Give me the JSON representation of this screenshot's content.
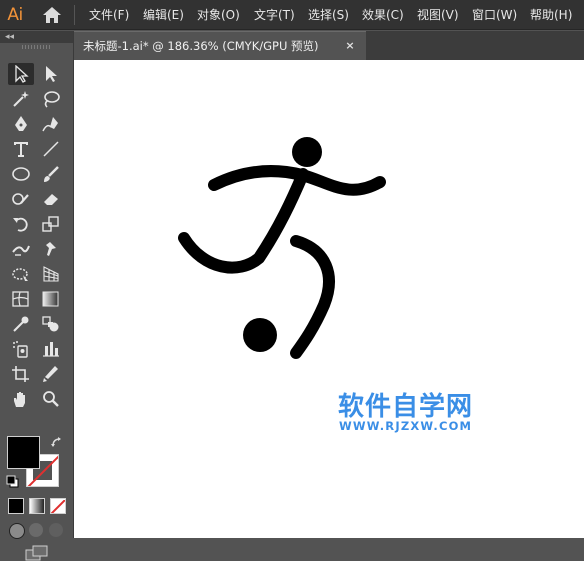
{
  "app": {
    "logo": "Ai"
  },
  "menu": [
    {
      "label": "文件(F)"
    },
    {
      "label": "编辑(E)"
    },
    {
      "label": "对象(O)"
    },
    {
      "label": "文字(T)"
    },
    {
      "label": "选择(S)"
    },
    {
      "label": "效果(C)"
    },
    {
      "label": "视图(V)"
    },
    {
      "label": "窗口(W)"
    },
    {
      "label": "帮助(H)"
    }
  ],
  "document_tab": {
    "title": "未标题-1.ai* @ 186.36% (CMYK/GPU 预览)",
    "close": "×"
  },
  "toolbar": {
    "collapse": "◂◂"
  },
  "colors": {
    "accent": "#f29339",
    "watermark": "#3a8ee6",
    "fill": "#000000",
    "stroke": "#ffffff"
  },
  "watermark": {
    "title": "软件自学网",
    "url": "WWW.RJZXW.COM"
  },
  "tools": [
    "selection-icon",
    "direct-selection-icon",
    "magic-wand-icon",
    "lasso-icon",
    "pen-icon",
    "curvature-icon",
    "type-icon",
    "line-segment-icon",
    "ellipse-icon",
    "paintbrush-icon",
    "shaper-icon",
    "eraser-icon",
    "rotate-icon",
    "scale-icon",
    "width-icon",
    "puppet-warp-icon",
    "free-transform-icon",
    "perspective-grid-icon",
    "mesh-icon",
    "gradient-icon",
    "eyedropper-icon",
    "blend-icon",
    "symbol-sprayer-icon",
    "column-graph-icon",
    "artboard-icon",
    "slice-icon",
    "hand-icon",
    "zoom-icon"
  ]
}
